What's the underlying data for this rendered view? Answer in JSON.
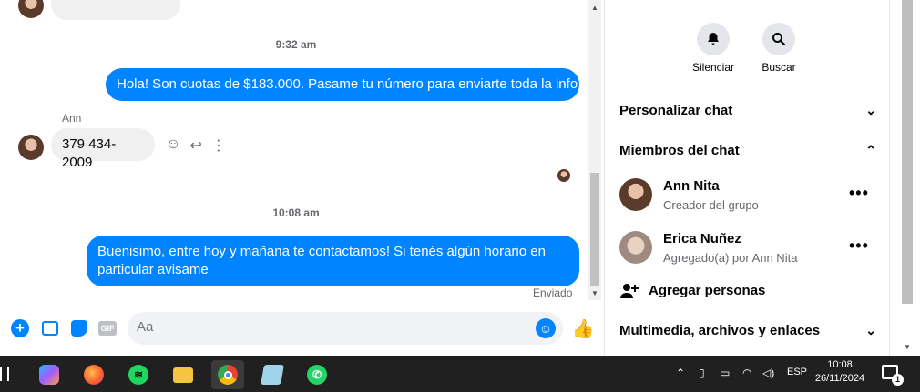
{
  "chat": {
    "timestamps": [
      "9:32 am",
      "10:08 am"
    ],
    "messages": [
      {
        "text": "Hola! Son cuotas de $183.000. Pasame tu número para enviarte toda la info"
      },
      {
        "sender": "Ann",
        "text": "379 434-2009"
      },
      {
        "text": "Buenisimo, entre hoy y mañana te contactamos! Si tenés algún horario en particular avisame",
        "status": "Enviado"
      }
    ]
  },
  "composer": {
    "placeholder": "Aa"
  },
  "side": {
    "actions": [
      {
        "label": "Silenciar",
        "icon": "bell-icon"
      },
      {
        "label": "Buscar",
        "icon": "search-icon"
      }
    ],
    "sections": {
      "customize": "Personalizar chat",
      "members": "Miembros del chat",
      "media": "Multimedia, archivos y enlaces"
    },
    "members": [
      {
        "name": "Ann Nita",
        "role": "Creador del grupo"
      },
      {
        "name": "Erica Nuñez",
        "role": "Agregado(a) por Ann Nita"
      }
    ],
    "add_people": "Agregar personas"
  },
  "taskbar": {
    "apps": [
      "copilot-icon",
      "firefox-icon",
      "spotify-icon",
      "file-explorer-icon",
      "chrome-icon",
      "notepad-icon",
      "whatsapp-icon"
    ],
    "language": "ESP",
    "time": "10:08",
    "date": "26/11/2024",
    "notification_count": "1"
  }
}
